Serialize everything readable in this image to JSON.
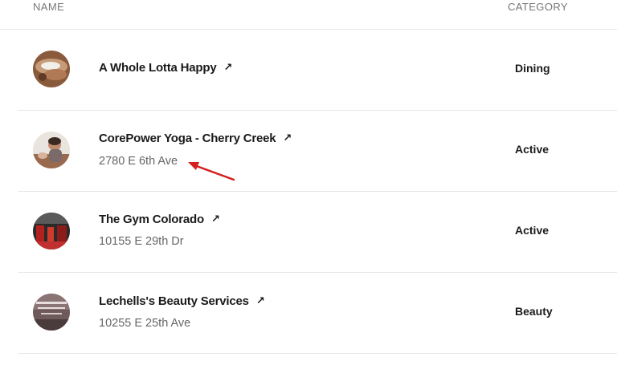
{
  "header": {
    "name_label": "NAME",
    "category_label": "CATEGORY"
  },
  "rows": [
    {
      "title": "A Whole Lotta Happy",
      "address": "",
      "category": "Dining",
      "ext_icon": "↗"
    },
    {
      "title": "CorePower Yoga - Cherry Creek",
      "address": "2780 E 6th Ave",
      "category": "Active",
      "ext_icon": "↗"
    },
    {
      "title": "The Gym Colorado",
      "address": "10155 E 29th Dr",
      "category": "Active",
      "ext_icon": "↗"
    },
    {
      "title": "Lechells's Beauty Services",
      "address": "10255 E 25th Ave",
      "category": "Beauty",
      "ext_icon": "↗"
    }
  ],
  "icons": {
    "external_link": "external-link-icon",
    "annotation": "red-arrow-annotation"
  },
  "colors": {
    "annotation_red": "#d41f1f",
    "divider": "#e6e6e6",
    "header_text": "#777777",
    "address_text": "#666666"
  }
}
